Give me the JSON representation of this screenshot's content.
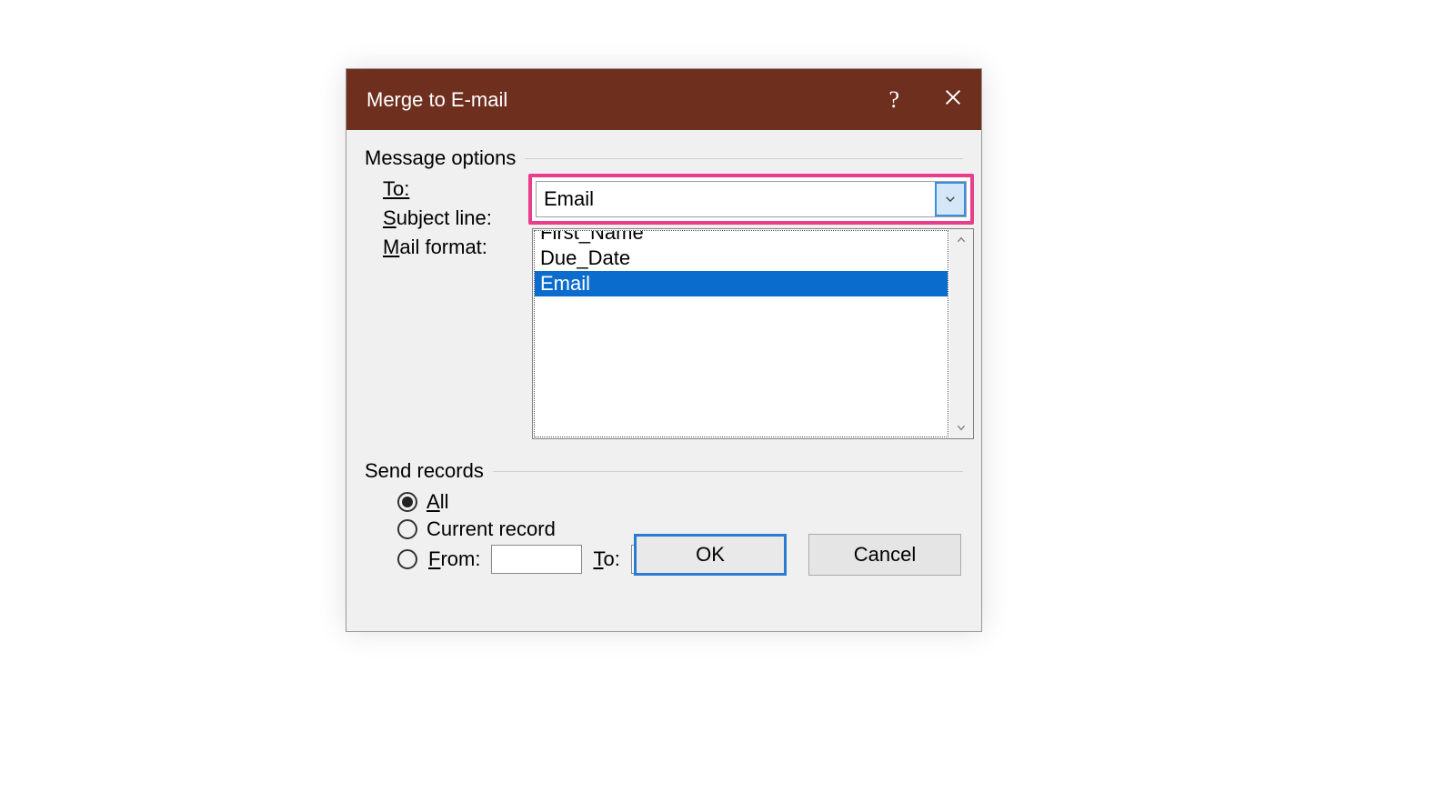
{
  "dialog": {
    "title": "Merge to E-mail",
    "help_symbol": "?"
  },
  "groups": {
    "message_options": "Message options",
    "send_records": "Send records"
  },
  "labels": {
    "to": "To:",
    "subject_line_prefix": "S",
    "subject_line_rest": "ubject line:",
    "mail_format_prefix": "M",
    "mail_format_rest": "ail format:",
    "all_prefix": "A",
    "all_rest": "ll",
    "current_record": "Current record",
    "from_prefix": "F",
    "from_rest": "rom:",
    "to_range_prefix": "T",
    "to_range_rest": "o:"
  },
  "combo": {
    "value": "Email",
    "options": {
      "first_name": "First_Name",
      "due_date": "Due_Date",
      "email": "Email"
    },
    "selected_index": 2
  },
  "buttons": {
    "ok": "OK",
    "cancel": "Cancel"
  }
}
